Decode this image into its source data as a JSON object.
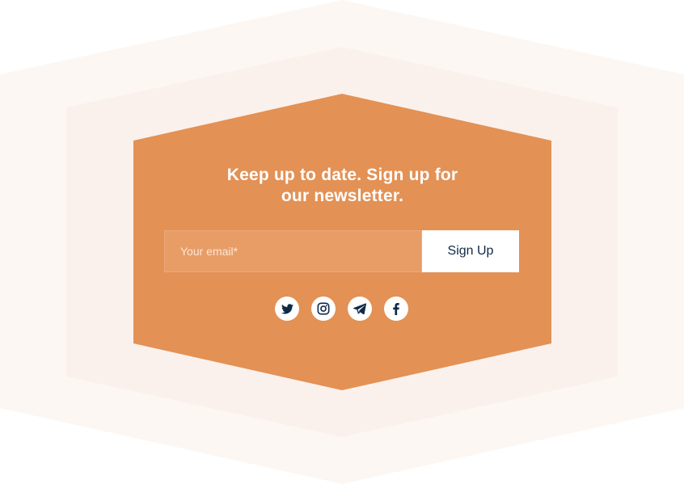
{
  "colors": {
    "background": "#ffffff",
    "outer_hexagon": "#fdf7f3",
    "middle_hexagon": "#fbf1ec",
    "card": "#e39155",
    "input_bg": "#e89d67",
    "button_text": "#0f2a47",
    "icon": "#0f2a47"
  },
  "newsletter": {
    "headline_line1": "Keep up to date. Sign up for",
    "headline_line2": "our newsletter.",
    "email_placeholder": "Your email*",
    "email_value": "",
    "signup_label": "Sign Up"
  },
  "social": {
    "icons": [
      "twitter-icon",
      "instagram-icon",
      "telegram-icon",
      "facebook-icon"
    ]
  }
}
